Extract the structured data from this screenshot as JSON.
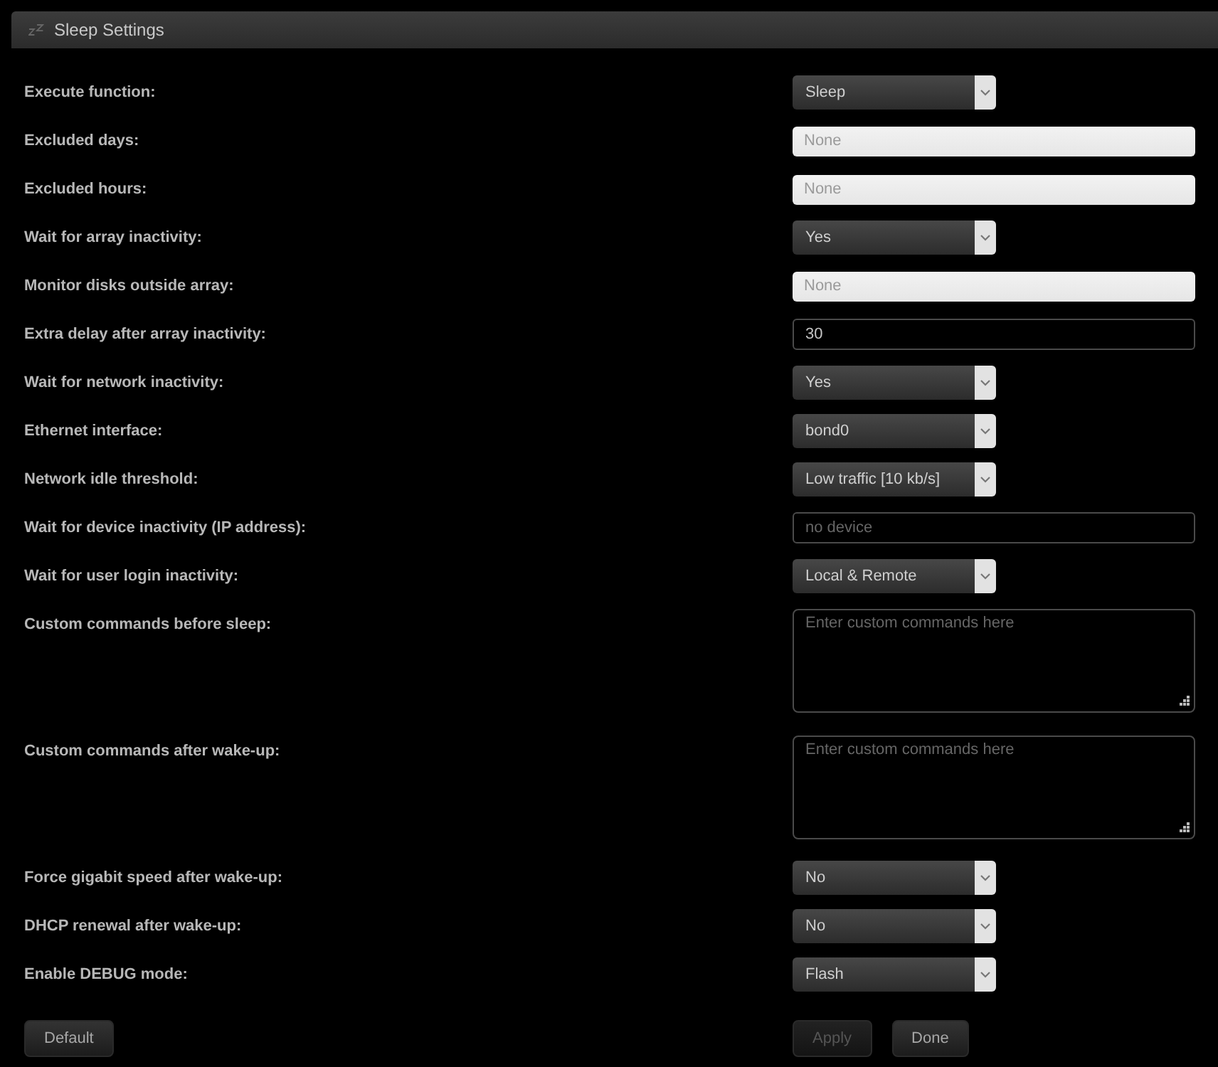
{
  "header": {
    "title": "Sleep Settings"
  },
  "fields": [
    {
      "label": "Execute function:",
      "kind": "select",
      "value": "Sleep"
    },
    {
      "label": "Excluded days:",
      "kind": "picker",
      "placeholder": "None"
    },
    {
      "label": "Excluded hours:",
      "kind": "picker",
      "placeholder": "None"
    },
    {
      "label": "Wait for array inactivity:",
      "kind": "select",
      "value": "Yes"
    },
    {
      "label": "Monitor disks outside array:",
      "kind": "picker",
      "placeholder": "None"
    },
    {
      "label": "Extra delay after array inactivity:",
      "kind": "text",
      "value": "30"
    },
    {
      "label": "Wait for network inactivity:",
      "kind": "select",
      "value": "Yes"
    },
    {
      "label": "Ethernet interface:",
      "kind": "select",
      "value": "bond0"
    },
    {
      "label": "Network idle threshold:",
      "kind": "select",
      "value": "Low traffic [10 kb/s]"
    },
    {
      "label": "Wait for device inactivity (IP address):",
      "kind": "text",
      "placeholder": "no device"
    },
    {
      "label": "Wait for user login inactivity:",
      "kind": "select",
      "value": "Local & Remote"
    },
    {
      "label": "Custom commands before sleep:",
      "kind": "textarea",
      "placeholder": "Enter custom commands here"
    },
    {
      "label": "Custom commands after wake-up:",
      "kind": "textarea",
      "placeholder": "Enter custom commands here"
    },
    {
      "label": "Force gigabit speed after wake-up:",
      "kind": "select",
      "value": "No"
    },
    {
      "label": "DHCP renewal after wake-up:",
      "kind": "select",
      "value": "No"
    },
    {
      "label": "Enable DEBUG mode:",
      "kind": "select",
      "value": "Flash"
    }
  ],
  "footer": {
    "left": [
      {
        "label": "Default",
        "disabled": false
      }
    ],
    "right": [
      {
        "label": "Apply",
        "disabled": true
      },
      {
        "label": "Done",
        "disabled": false
      }
    ]
  }
}
